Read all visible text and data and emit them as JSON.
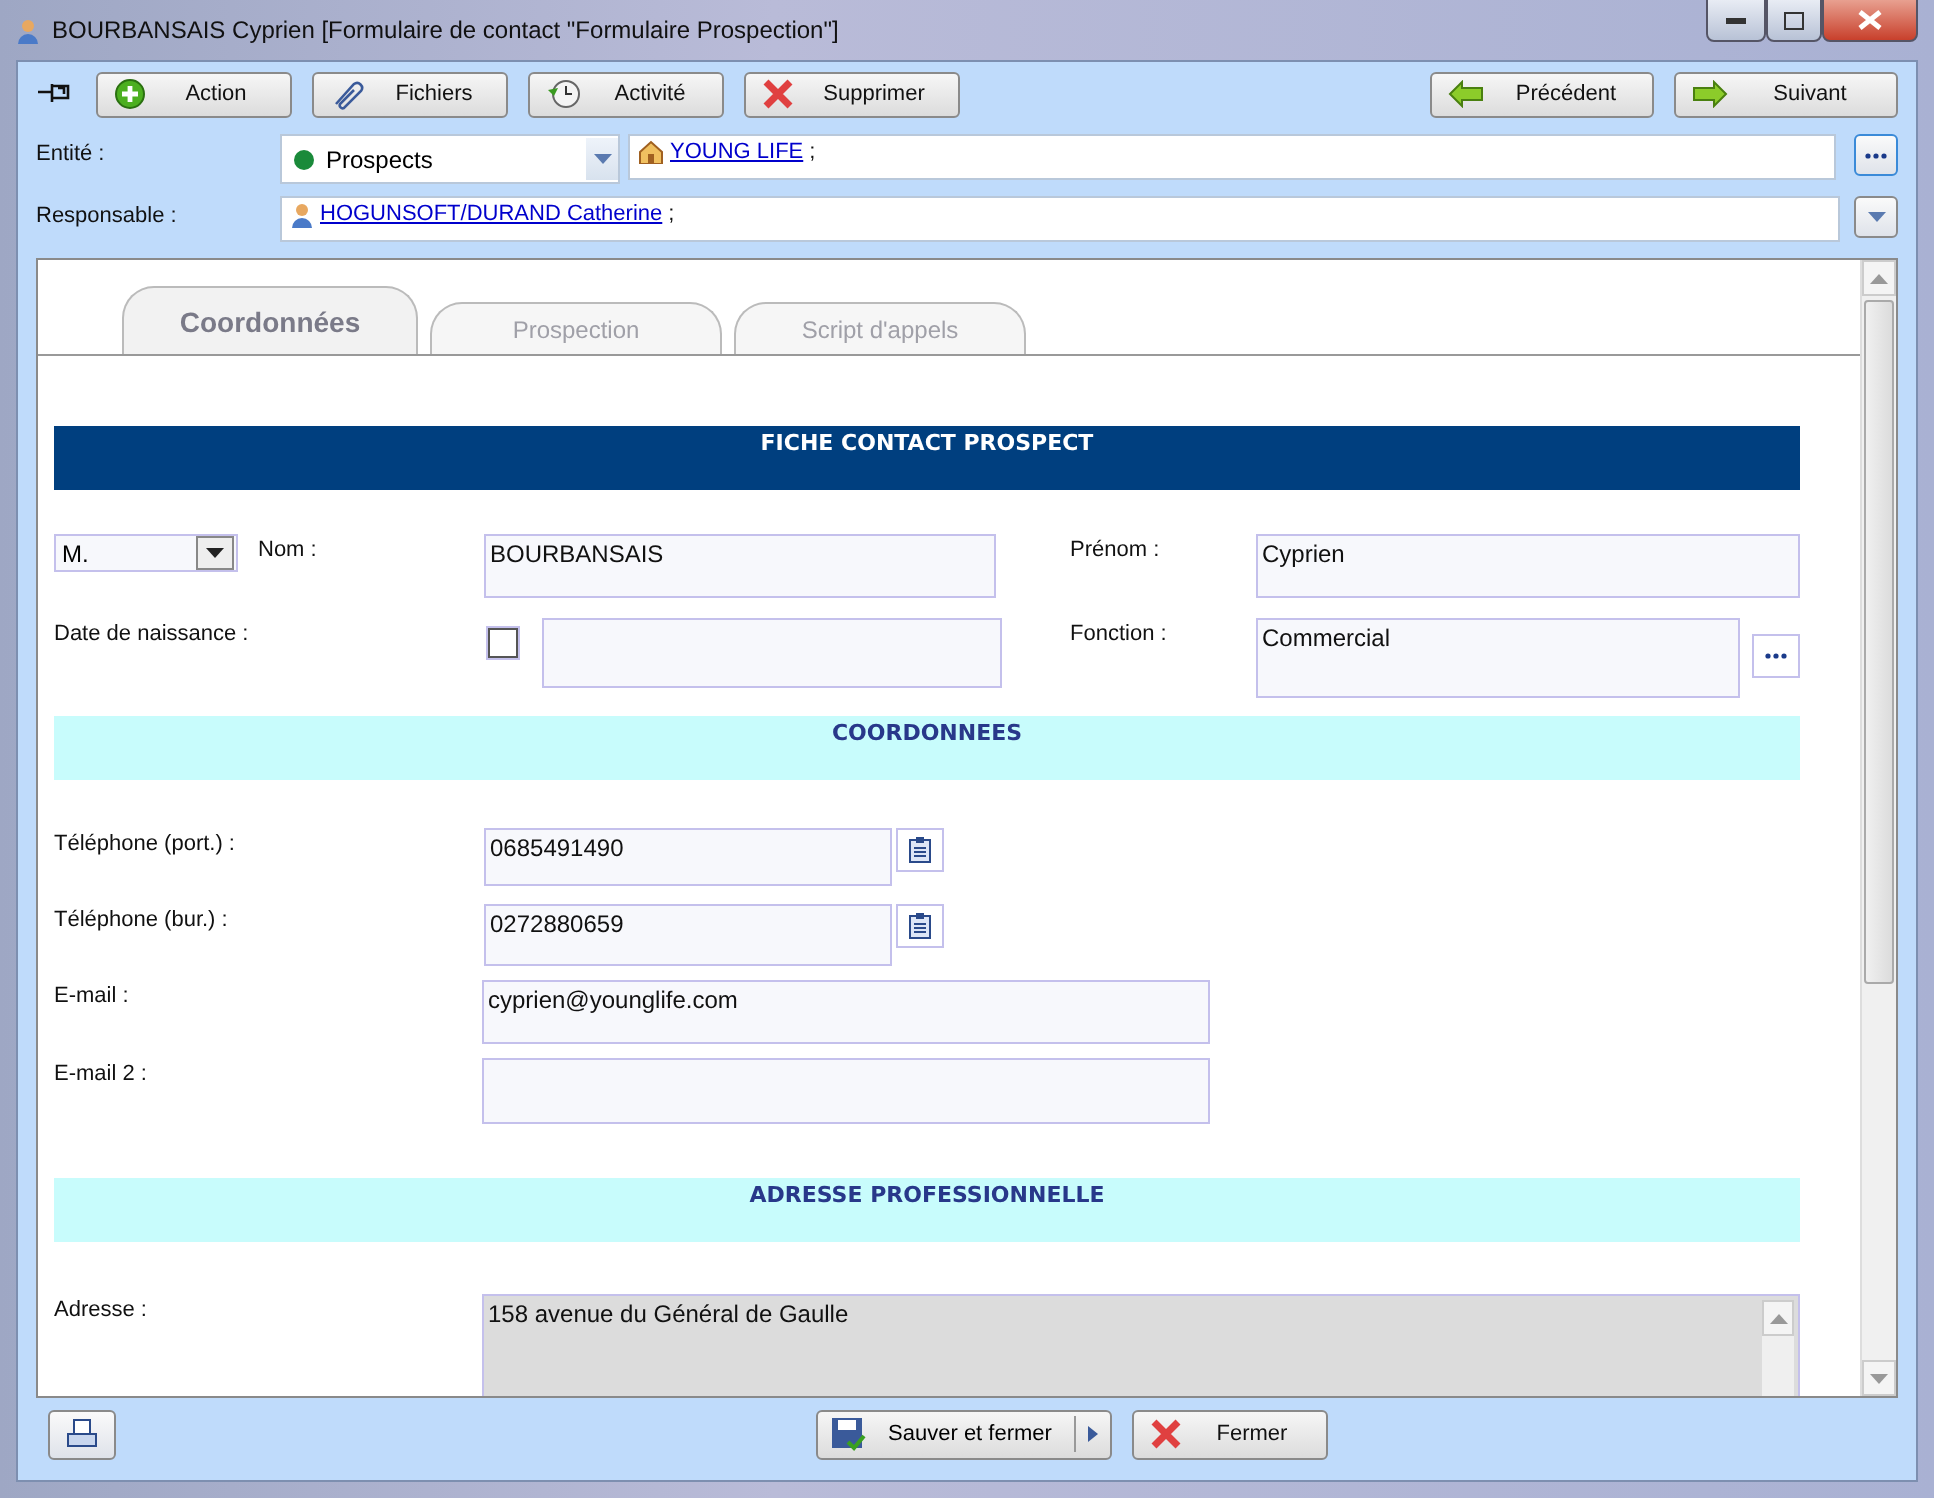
{
  "window": {
    "title": "BOURBANSAIS Cyprien [Formulaire de contact \"Formulaire Prospection\"]"
  },
  "toolbar": {
    "left": [
      {
        "label": "Action",
        "kind": "add"
      },
      {
        "label": "Fichiers",
        "kind": "clip"
      },
      {
        "label": "Activité",
        "kind": "history"
      },
      {
        "label": "Supprimer",
        "kind": "delete"
      }
    ],
    "right": [
      {
        "label": "Précédent",
        "kind": "back"
      },
      {
        "label": "Suivant",
        "kind": "next"
      }
    ]
  },
  "entity": {
    "label": "Entité :",
    "category": "Prospects",
    "color": "#1a8a3a",
    "link": "YOUNG LIFE",
    "suffix": ";"
  },
  "owner": {
    "label": "Responsable :",
    "link": "HOGUNSOFT/DURAND Catherine",
    "suffix": ";"
  },
  "tabs": [
    {
      "label": "Coordonnées",
      "selected": true
    },
    {
      "label": "Prospection",
      "selected": false
    },
    {
      "label": "Script d'appels",
      "selected": false
    }
  ],
  "form": {
    "header": "FICHE CONTACT PROSPECT",
    "civility": "M.",
    "name": {
      "label": "Nom :",
      "value": "BOURBANSAIS"
    },
    "first_name": {
      "label": "Prénom :",
      "value": "Cyprien"
    },
    "birth_date": {
      "label": "Date de naissance :",
      "checked": false
    },
    "function": {
      "label": "Fonction :",
      "value": "Commercial"
    },
    "contact_header": "COORDONNEES",
    "phones": [
      {
        "label": "Téléphone (port.) :",
        "value": "0685491490"
      },
      {
        "label": "Téléphone (bur.) :",
        "value": "0272880659"
      }
    ],
    "emails": [
      {
        "label": "E-mail :",
        "value": "cyprien@younglife.com"
      },
      {
        "label": "E-mail 2 :"
      }
    ],
    "address_header": "ADRESSE PROFESSIONNELLE",
    "address": {
      "label": "Adresse  :",
      "value": "158 avenue du Général de Gaulle"
    }
  },
  "footer": {
    "save": "Sauver et fermer",
    "close": "Fermer"
  }
}
